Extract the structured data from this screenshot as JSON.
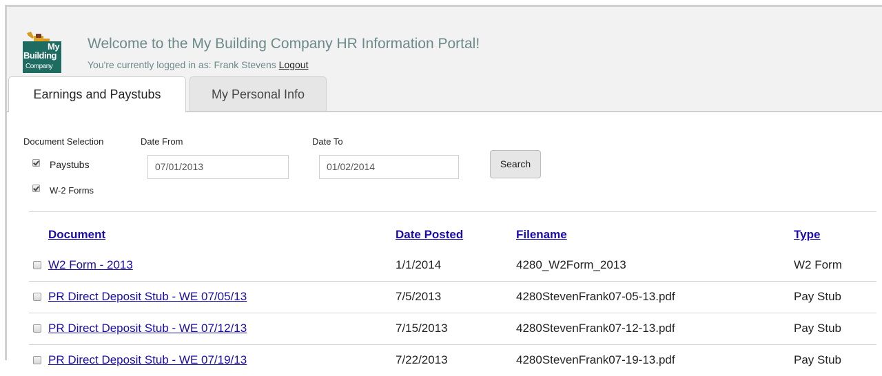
{
  "header": {
    "logo": {
      "line1": "My",
      "line2": "Building",
      "line3": "Company"
    },
    "welcome": "Welcome to the My Building Company HR Information Portal!",
    "logged_in_prefix": "You're currently logged in as: Frank Stevens",
    "logout_label": "Logout"
  },
  "tabs": [
    {
      "label": "Earnings and Paystubs",
      "active": true
    },
    {
      "label": "My Personal Info",
      "active": false
    }
  ],
  "filters": {
    "document_selection_label": "Document Selection",
    "options": [
      {
        "label": "Paystubs",
        "checked": true
      },
      {
        "label": "W-2 Forms",
        "checked": true
      }
    ],
    "date_from_label": "Date From",
    "date_from_value": "07/01/2013",
    "date_to_label": "Date To",
    "date_to_value": "01/02/2014",
    "search_label": "Search"
  },
  "table": {
    "columns": [
      "Document",
      "Date Posted",
      "Filename",
      "Type"
    ],
    "rows": [
      {
        "document": "W2 Form - 2013",
        "date_posted": "1/1/2014",
        "filename": "4280_W2Form_2013",
        "type": "W2 Form",
        "checked": false
      },
      {
        "document": "PR Direct Deposit Stub - WE 07/05/13",
        "date_posted": "7/5/2013",
        "filename": "4280StevenFrank07-05-13.pdf",
        "type": "Pay Stub",
        "checked": false
      },
      {
        "document": "PR Direct Deposit Stub - WE 07/12/13",
        "date_posted": "7/15/2013",
        "filename": "4280StevenFrank07-12-13.pdf",
        "type": "Pay Stub",
        "checked": false
      },
      {
        "document": "PR Direct Deposit Stub - WE 07/19/13",
        "date_posted": "7/22/2013",
        "filename": "4280StevenFrank07-19-13.pdf",
        "type": "Pay Stub",
        "checked": false
      }
    ]
  }
}
